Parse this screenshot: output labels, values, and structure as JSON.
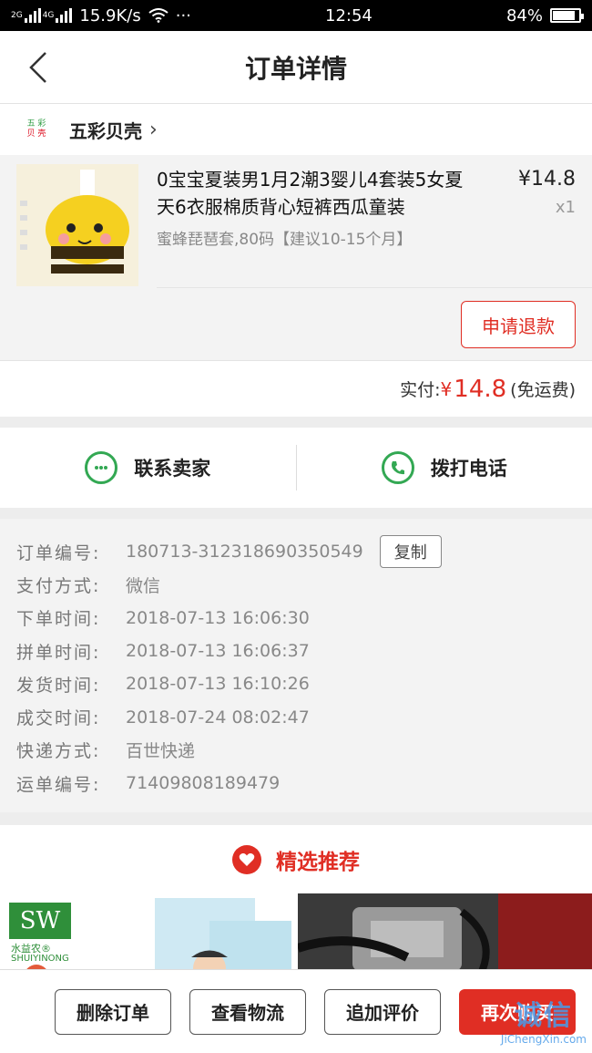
{
  "status": {
    "net1": "2G",
    "net2": "4G",
    "speed": "15.9K/s",
    "dots": "···",
    "time": "12:54",
    "battery": "84%",
    "battery_level": 0.84
  },
  "header": {
    "title": "订单详情"
  },
  "shop": {
    "logo_top": "五 彩",
    "logo_bottom": "贝 壳",
    "name": "五彩贝壳",
    "chevron": "›"
  },
  "product": {
    "title": "0宝宝夏装男1月2潮3婴儿4套装5女夏天6衣服棉质背心短裤西瓜童装",
    "spec": "蜜蜂琵琶套,80码【建议10-15个月】",
    "price": "¥14.8",
    "qty": "x1",
    "refund_label": "申请退款"
  },
  "payment": {
    "label": "实付:",
    "currency": "¥",
    "amount": "14.8",
    "note": "(免运费)"
  },
  "contact": {
    "seller_label": "联系卖家",
    "call_label": "拨打电话"
  },
  "order_info": {
    "copy_label": "复制",
    "rows": [
      {
        "label": "订单编号:",
        "value": "180713-312318690350549"
      },
      {
        "label": "支付方式:",
        "value": "微信"
      },
      {
        "label": "下单时间:",
        "value": "2018-07-13 16:06:30"
      },
      {
        "label": "拼单时间:",
        "value": "2018-07-13 16:06:37"
      },
      {
        "label": "发货时间:",
        "value": "2018-07-13 16:10:26"
      },
      {
        "label": "成交时间:",
        "value": "2018-07-24 08:02:47"
      },
      {
        "label": "快递方式:",
        "value": "百世快递"
      },
      {
        "label": "运单编号:",
        "value": "71409808189479"
      }
    ]
  },
  "recommend": {
    "title": "精选推荐",
    "brand_logo": "SW",
    "brand_cn": "水益农®",
    "brand_en": "SHUIYINONG"
  },
  "actions": {
    "delete": "删除订单",
    "logistics": "查看物流",
    "review": "追加评价",
    "rebuy": "再次购买"
  },
  "watermark": {
    "line1": "诚信",
    "line2": "JiChengXin.com"
  },
  "colors": {
    "accent": "#e02e24",
    "green": "#33a853",
    "text": "#222222"
  }
}
